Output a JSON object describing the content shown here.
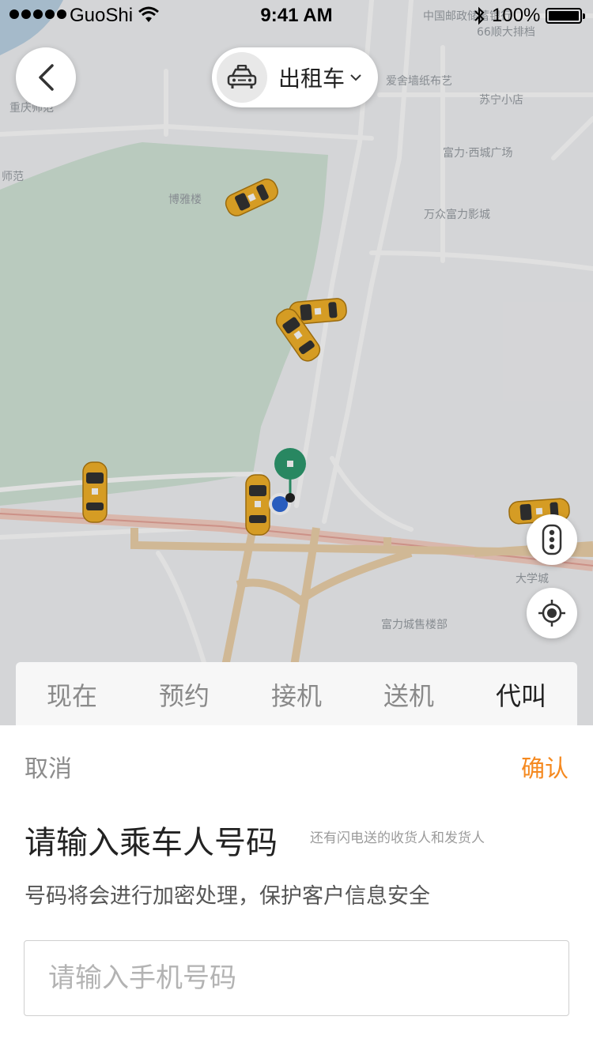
{
  "status_bar": {
    "carrier": "GuoShi",
    "time": "9:41 AM",
    "battery": "100%"
  },
  "header": {
    "vehicle_type": "出租车"
  },
  "map": {
    "labels": {
      "top_right_1": "中国邮政储蓄银行",
      "top_right_2": "66顺大排档",
      "love_shop": "爱舍墙纸布艺",
      "suning": "苏宁小店",
      "fuli_west": "富力·西城广场",
      "wanzhong": "万众富力影城",
      "chongqing": "重庆师范",
      "shifan": "师范",
      "boya": "博雅楼",
      "daxuecheng": "大学城",
      "sales_office": "富力城售楼部"
    }
  },
  "tabs": [
    {
      "label": "现在"
    },
    {
      "label": "预约"
    },
    {
      "label": "接机"
    },
    {
      "label": "送机"
    },
    {
      "label": "代叫"
    }
  ],
  "sheet": {
    "cancel": "取消",
    "confirm": "确认",
    "title": "请输入乘车人号码",
    "hint": "还有闪电送的收货人和发货人",
    "subtitle": "号码将会进行加密处理，保护客户信息安全",
    "phone_placeholder": "请输入手机号码"
  },
  "colors": {
    "accent": "#f5891f",
    "park": "#cfe3d5",
    "road": "#ffffff",
    "major_road": "#f1d3a6",
    "pin": "#2e9a6f"
  }
}
